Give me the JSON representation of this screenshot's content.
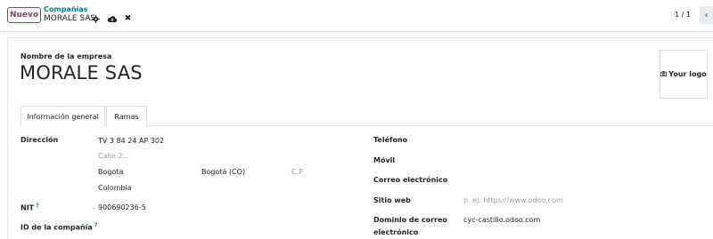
{
  "toolbar": {
    "new_label": "Nuevo",
    "breadcrumb_parent": "Compañías",
    "breadcrumb_current": "MORALE SAS",
    "discard_glyph": "✖",
    "pager_value": "1 / 1",
    "pager_prev_glyph": "‹"
  },
  "company": {
    "name_label": "Nombre de la empresa",
    "name": "MORALE SAS",
    "logo_label": "Your logo"
  },
  "tabs": [
    {
      "label": "Información general",
      "active": true
    },
    {
      "label": "Ramas",
      "active": false
    }
  ],
  "address": {
    "label": "Dirección",
    "street": "TV 3 84 24 AP 302",
    "street2_placeholder": "Calle 2...",
    "city": "Bogota",
    "state": "Bogotá (CO)",
    "zip_placeholder": "C.P.",
    "country": "Colombia"
  },
  "nit": {
    "label": "NIT",
    "help": "?",
    "value": "900690236-5"
  },
  "company_id": {
    "label": "ID de la compañía",
    "help": "?"
  },
  "contact": {
    "phone_label": "Teléfono",
    "mobile_label": "Móvil",
    "email_label": "Correo electrónico",
    "website_label": "Sitio web",
    "website_placeholder": "p. ej. https://www.odoo.com",
    "email_domain_label_line1": "Dominio de correo",
    "email_domain_label_line2": "electrónico",
    "email_domain_value": "cyc-castillo.odoo.com"
  },
  "icons": {
    "gear": "gear-icon",
    "cloud": "cloud-upload-icon",
    "discard": "close-icon",
    "camera": "camera-icon"
  },
  "colors": {
    "brand": "#7c4a6a",
    "link": "#017e84",
    "placeholder": "#9aa0a6"
  }
}
